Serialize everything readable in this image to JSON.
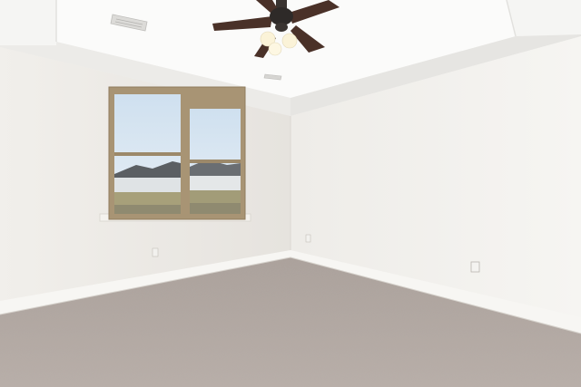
{
  "scene": {
    "kind": "empty-room-interior",
    "colors": {
      "wall_left": "#efede9",
      "wall_right": "#f3f1ee",
      "ceiling": "#f7f7f5",
      "tray_recess": "#fbfbfa",
      "baseboard": "#f4f3f0",
      "carpet": "#b3a8a2",
      "carpet_dark": "#9c918b",
      "window_frame": "#a89474",
      "sky": "#d8e6f2",
      "fan_blade": "#4a3128",
      "fan_motor": "#2e2a28",
      "light_glass": "#fbf3d8"
    },
    "objects": [
      {
        "name": "ceiling-fan",
        "icon": "ceiling-fan-icon",
        "blade_count": 5,
        "light_count": 3
      },
      {
        "name": "window",
        "icon": "window-icon",
        "panes": 2
      },
      {
        "name": "hvac-vent",
        "icon": "vent-icon",
        "count": 2
      },
      {
        "name": "electrical-outlet",
        "icon": "outlet-icon",
        "count": 3
      },
      {
        "name": "carpet-floor",
        "icon": "carpet-icon"
      },
      {
        "name": "tray-ceiling",
        "icon": "tray-ceiling-icon"
      }
    ]
  }
}
